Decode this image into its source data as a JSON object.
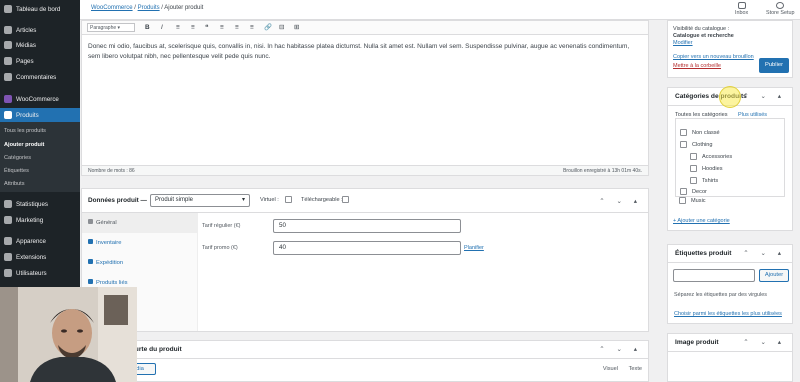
{
  "sidebar": {
    "items": [
      {
        "label": "Tableau de bord",
        "icon": "dashboard-icon"
      },
      {
        "label": "Articles",
        "icon": "pin-icon"
      },
      {
        "label": "Médias",
        "icon": "media-icon"
      },
      {
        "label": "Pages",
        "icon": "page-icon"
      },
      {
        "label": "Commentaires",
        "icon": "comment-icon"
      },
      {
        "label": "WooCommerce",
        "icon": "woocommerce-icon"
      },
      {
        "label": "Produits",
        "icon": "product-icon"
      },
      {
        "label": "Statistiques",
        "icon": "chart-icon"
      },
      {
        "label": "Marketing",
        "icon": "megaphone-icon"
      },
      {
        "label": "Apparence",
        "icon": "brush-icon"
      },
      {
        "label": "Extensions",
        "icon": "plugin-icon"
      },
      {
        "label": "Utilisateurs",
        "icon": "users-icon"
      }
    ],
    "submenu": [
      "Tous les produits",
      "Ajouter produit",
      "Catégories",
      "Étiquettes",
      "Attributs"
    ]
  },
  "topbar": {
    "breadcrumb": {
      "root": "WooCommerce",
      "sep1": "/",
      "section": "Produits",
      "sep2": "/",
      "current": "Ajouter produit"
    },
    "inbox": "Inbox",
    "store_setup": "Store Setup"
  },
  "editor": {
    "format_select": "Paragraphe",
    "toolbar": [
      "B",
      "I",
      "≡",
      "≡",
      "❝",
      "≡",
      "≡",
      "≡",
      "🔗",
      "⊟",
      "⊞"
    ],
    "content": "Donec mi odio, faucibus at, scelerisque quis, convallis in, nisi. In hac habitasse platea dictumst. Nulla sit amet est. Nullam vel sem. Suspendisse pulvinar, augue ac venenatis condimentum, sem libero volutpat nibh, nec pellentesque velit pede quis nunc.",
    "word_count": "Nombre de mots : 86",
    "saved": "Brouillon enregistré à 13h 01m 40s."
  },
  "product_data": {
    "title": "Données produit —",
    "type": "Produit simple",
    "virtual": "Virtuel :",
    "downloadable": "Téléchargeable :",
    "tabs": [
      "Général",
      "Inventaire",
      "Expédition",
      "Produits liés"
    ],
    "regular_label": "Tarif régulier (€)",
    "regular_value": "50",
    "promo_label": "Tarif promo (€)",
    "promo_value": "40",
    "schedule": "Planifier"
  },
  "short_desc": {
    "title": "Description courte du produit",
    "add_media": "Ajouter un média",
    "visual": "Visuel",
    "text": "Texte"
  },
  "publish": {
    "visibility_label": "Visibilité du catalogue :",
    "visibility_value": "Catalogue et recherche",
    "modify": "Modifier",
    "copy_draft": "Copier vers un nouveau brouillon",
    "trash": "Mettre à la corbeille",
    "publish_button": "Publier"
  },
  "categories": {
    "title": "Catégories de produits",
    "tab_all": "Toutes les catégories",
    "tab_most": "Plus utilisés",
    "items": [
      {
        "label": "Non classé",
        "indent": 0
      },
      {
        "label": "Clothing",
        "indent": 0
      },
      {
        "label": "Accessories",
        "indent": 1
      },
      {
        "label": "Hoodies",
        "indent": 1
      },
      {
        "label": "Tshirts",
        "indent": 1
      },
      {
        "label": "Decor",
        "indent": 0
      },
      {
        "label": "Music",
        "indent": 0
      }
    ],
    "add": "+ Ajouter une catégorie"
  },
  "tags": {
    "title": "Étiquettes produit",
    "add_button": "Ajouter",
    "hint": "Séparez les étiquettes par des virgules",
    "choose": "Choisir parmi les étiquettes les plus utilisées"
  },
  "image": {
    "title": "Image produit"
  },
  "metabox_arrows": "⌃ ⌄ ▴"
}
